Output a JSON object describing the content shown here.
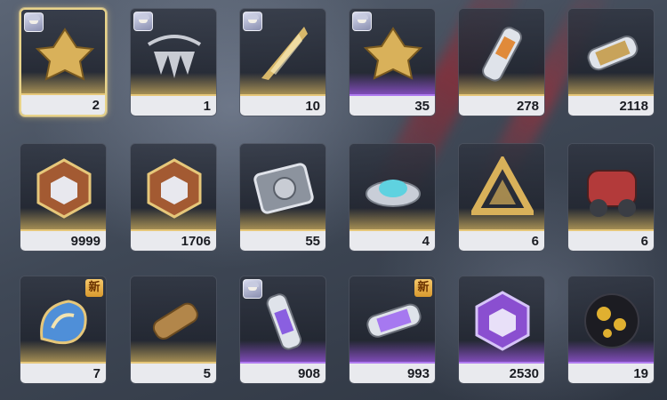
{
  "inventory": {
    "items": [
      {
        "name": "golden-crystal-flower",
        "qty": "2",
        "rarity": "gold",
        "portrait": true,
        "new": "",
        "selected": true,
        "color": "#d9b15a"
      },
      {
        "name": "silver-spiked-necklace",
        "qty": "1",
        "rarity": "gold",
        "portrait": true,
        "new": "",
        "selected": false,
        "color": "#c9ccd4"
      },
      {
        "name": "golden-feather-blade",
        "qty": "10",
        "rarity": "gold",
        "portrait": true,
        "new": "",
        "selected": false,
        "color": "#d8b86a"
      },
      {
        "name": "golden-crystal-flower-small",
        "qty": "35",
        "rarity": "purple",
        "portrait": true,
        "new": "",
        "selected": false,
        "color": "#d9b15a"
      },
      {
        "name": "orange-capsule-vial",
        "qty": "278",
        "rarity": "gold",
        "portrait": false,
        "new": "",
        "selected": false,
        "color": "#e08a3a"
      },
      {
        "name": "gold-canister-cylinder",
        "qty": "2118",
        "rarity": "gold",
        "portrait": false,
        "new": "",
        "selected": false,
        "color": "#c8a35a"
      },
      {
        "name": "bronze-polyhedral-core",
        "qty": "9999",
        "rarity": "gold",
        "portrait": false,
        "new": "",
        "selected": false,
        "color": "#a35a32"
      },
      {
        "name": "bronze-polyhedral-core-2",
        "qty": "1706",
        "rarity": "gold",
        "portrait": false,
        "new": "",
        "selected": false,
        "color": "#a35a32"
      },
      {
        "name": "circuit-chip-module",
        "qty": "55",
        "rarity": "gold",
        "portrait": false,
        "new": "",
        "selected": false,
        "color": "#8c939e"
      },
      {
        "name": "cyan-disc-device",
        "qty": "4",
        "rarity": "gold",
        "portrait": false,
        "new": "",
        "selected": false,
        "color": "#5fd2e0"
      },
      {
        "name": "golden-triangle-knot",
        "qty": "6",
        "rarity": "gold",
        "portrait": false,
        "new": "",
        "selected": false,
        "color": "#d9b15a"
      },
      {
        "name": "red-mechanical-part",
        "qty": "6",
        "rarity": "gold",
        "portrait": false,
        "new": "",
        "selected": false,
        "color": "#b33a3a"
      },
      {
        "name": "blue-gold-swirl-shell",
        "qty": "7",
        "rarity": "gold",
        "portrait": false,
        "new": "新",
        "selected": false,
        "color": "#4f8fd8"
      },
      {
        "name": "bronze-scroll-cylinder",
        "qty": "5",
        "rarity": "gold",
        "portrait": false,
        "new": "",
        "selected": false,
        "color": "#b2864a"
      },
      {
        "name": "purple-capsule-vial",
        "qty": "908",
        "rarity": "purple",
        "portrait": true,
        "new": "",
        "selected": false,
        "color": "#8a5fe0"
      },
      {
        "name": "purple-canister-cylinder",
        "qty": "993",
        "rarity": "purple",
        "portrait": false,
        "new": "新",
        "selected": false,
        "color": "#a678f0"
      },
      {
        "name": "purple-polyhedral-core",
        "qty": "2530",
        "rarity": "purple",
        "portrait": false,
        "new": "",
        "selected": false,
        "color": "#8a4fd0"
      },
      {
        "name": "black-gold-sphere",
        "qty": "19",
        "rarity": "purple",
        "portrait": false,
        "new": "",
        "selected": false,
        "color": "#e0b030"
      }
    ]
  }
}
